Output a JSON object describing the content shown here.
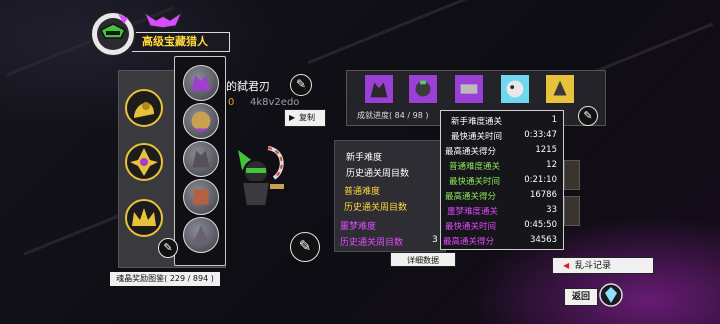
{
  "title": {
    "label": "高级宝藏猎人"
  },
  "player": {
    "name_fragment": "的弑君刃",
    "value_fragment": "0",
    "code": "4k8v2edo",
    "copy_label": "复制"
  },
  "collection": {
    "label": "魂晶奖励图鉴( 229 / 894 )"
  },
  "achievements": {
    "progress": "成就进度( 84 / 98 )",
    "icons": [
      "achievement-1-icon",
      "achievement-2-icon",
      "achievement-3-icon",
      "achievement-4-icon",
      "achievement-5-icon"
    ]
  },
  "modes": {
    "normal_title": "新手难度",
    "normal_cycles": "历史通关周目数",
    "standard_title": "普通难度",
    "standard_cycles": "历史通关周目数",
    "nightmare_title": "噩梦难度",
    "nightmare_cycles": "历史通关周目数",
    "nightmare_value_fragment": "3"
  },
  "detail_button": "详细数据",
  "popup": {
    "rows": [
      {
        "label": "新手难度通关",
        "value": "1"
      },
      {
        "label": "最快通关时间",
        "value": "0:33:47"
      },
      {
        "label": "最高通关得分",
        "value": "1215"
      },
      {
        "label": "普通难度通关",
        "value": "12"
      },
      {
        "label": "最快通关时间",
        "value": "0:21:10"
      },
      {
        "label": "最高通关得分",
        "value": "16786"
      },
      {
        "label": "噩梦难度通关",
        "value": "33"
      },
      {
        "label": "最快通关时间",
        "value": "0:45:50"
      },
      {
        "label": "最高通关得分",
        "value": "34563"
      }
    ]
  },
  "record_button": "乱斗记录",
  "back_button": "返回",
  "colors": {
    "gold": "#ffd83a",
    "green": "#8ee85a",
    "magenta": "#e04cff",
    "achievement_purple": "#9b3fd6",
    "achievement_cyan": "#6fd7f0",
    "achievement_yellow": "#e8c23a"
  }
}
